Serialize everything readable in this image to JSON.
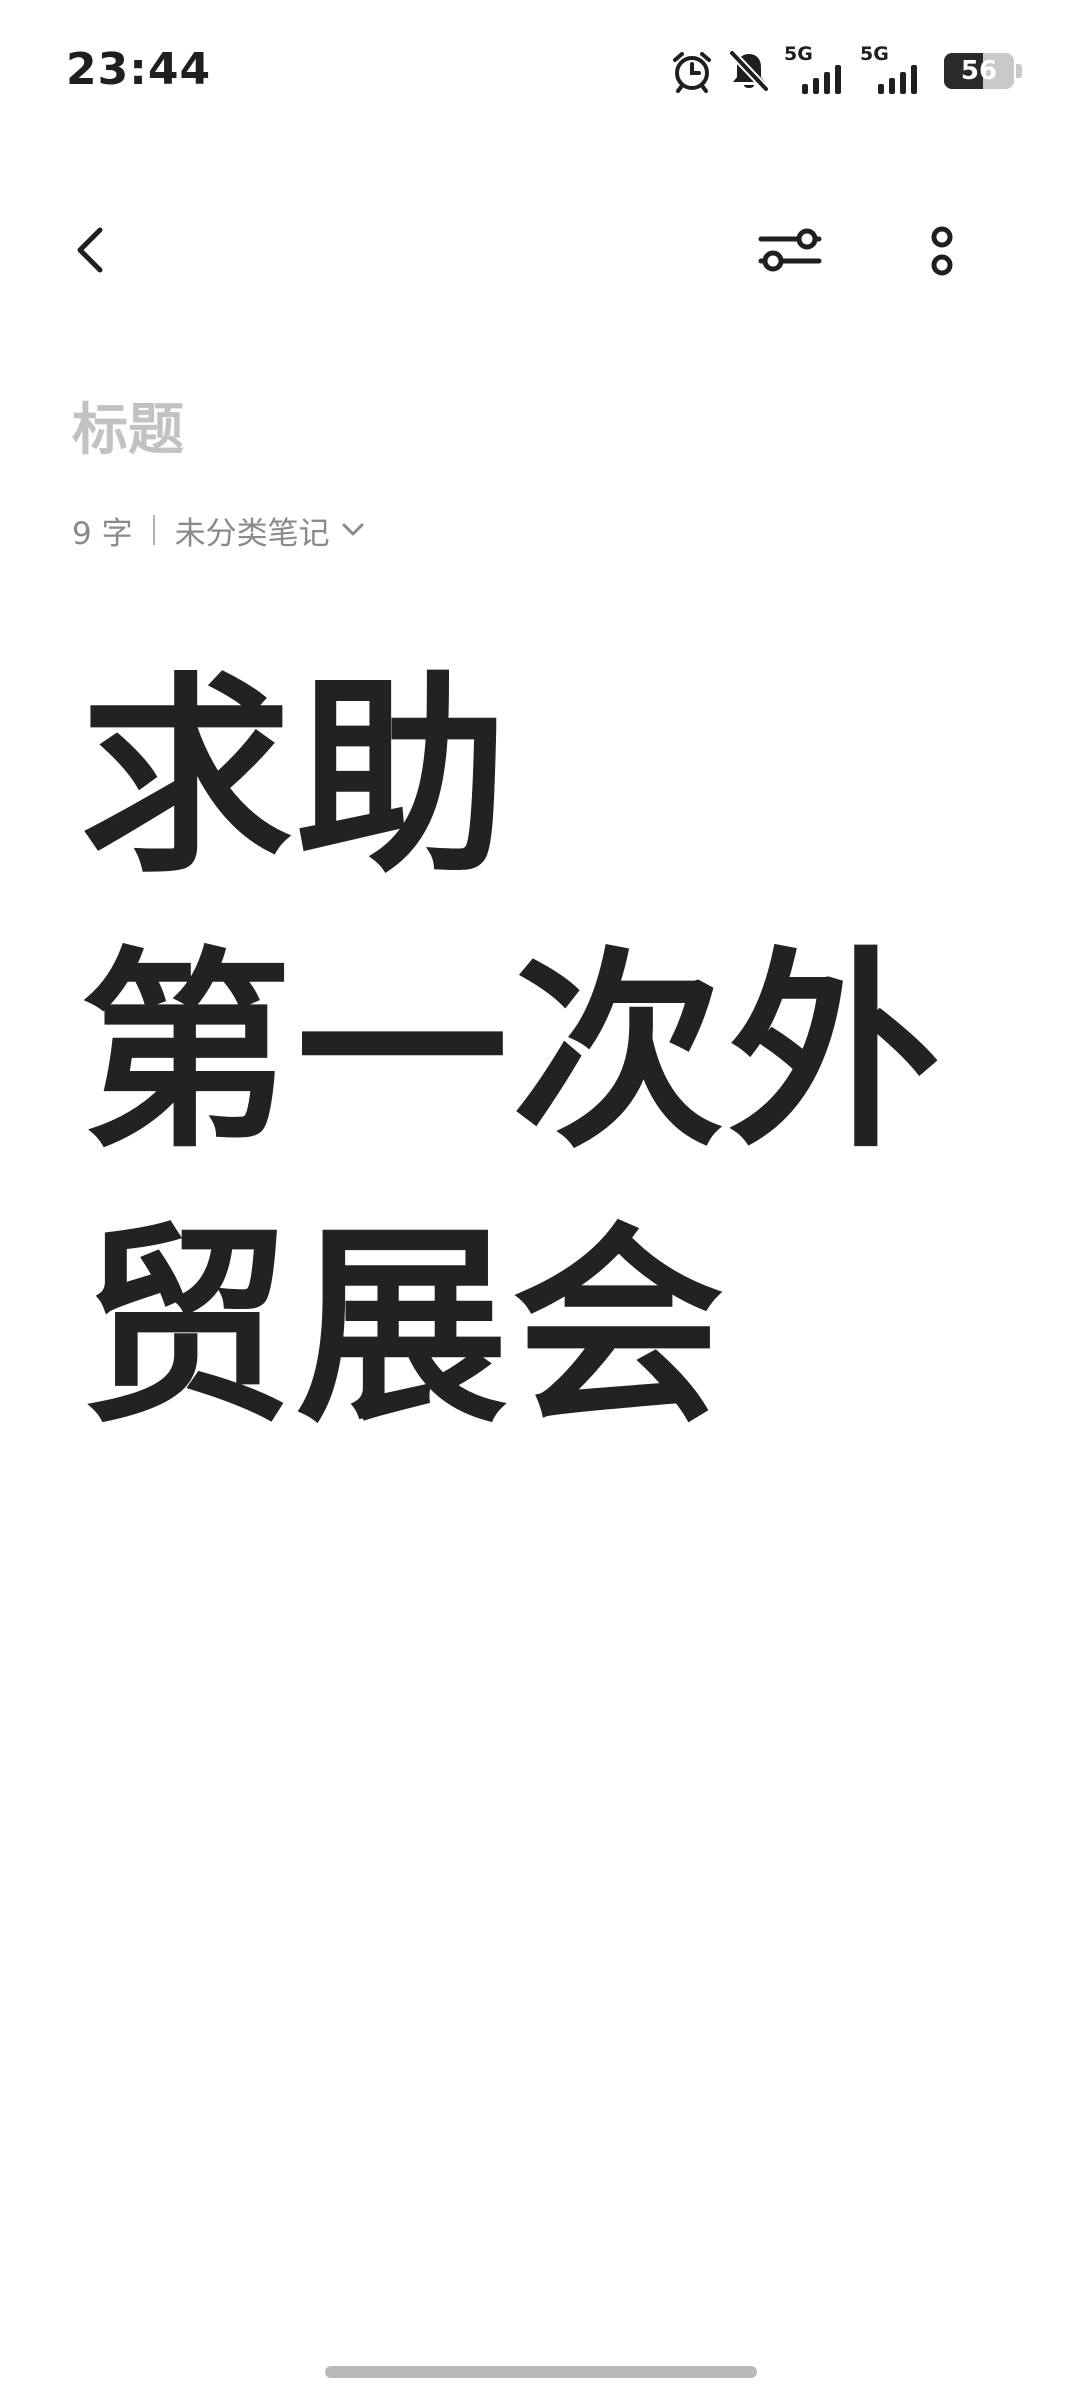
{
  "status_bar": {
    "time": "23:44",
    "signal1_label": "5G",
    "signal2_label": "5G",
    "battery_percent": 56,
    "battery_text": "56"
  },
  "toolbar": {
    "back_icon": "chevron-left-icon",
    "format_icon": "sliders-icon",
    "more_icon": "more-vertical-icon"
  },
  "note": {
    "title_placeholder": "标题",
    "title_value": "",
    "word_count": "9 字",
    "category": "未分类笔记",
    "body_lines": [
      "求助",
      "第一次外",
      "贸展会"
    ]
  },
  "colors": {
    "text": "#222222",
    "placeholder": "#c2c2c2",
    "meta": "#8a8a8a",
    "background": "#ffffff"
  }
}
